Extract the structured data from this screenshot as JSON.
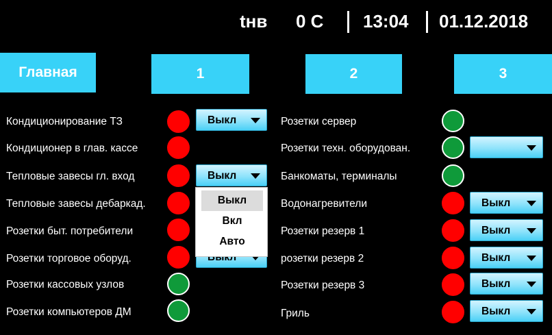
{
  "header": {
    "indicator_label": "tнв",
    "temperature": "0 C",
    "time": "13:04",
    "date": "01.12.2018"
  },
  "nav": [
    {
      "label": "Главная"
    },
    {
      "label": "1"
    },
    {
      "label": "2"
    },
    {
      "label": "3"
    }
  ],
  "left_rows": [
    {
      "label": "Кондиционирование ТЗ",
      "status": "red",
      "control": "Выкл"
    },
    {
      "label": "Кондиционер в глав. кассе",
      "status": "red"
    },
    {
      "label": "Тепловые завесы гл. вход",
      "status": "red",
      "control": "Выкл"
    },
    {
      "label": "Тепловые завесы дебаркад.",
      "status": "red"
    },
    {
      "label": "Розетки быт. потребители",
      "status": "red"
    },
    {
      "label": "Розетки торговое оборуд.",
      "status": "red",
      "control": "Выкл"
    },
    {
      "label": "Розетки кассовых узлов",
      "status": "green"
    },
    {
      "label": "Розетки компьютеров ДМ",
      "status": "green"
    }
  ],
  "right_rows": [
    {
      "label": "Розетки сервер",
      "status": "green"
    },
    {
      "label": "Розетки техн. оборудован.",
      "status": "green",
      "control": ""
    },
    {
      "label": "Банкоматы, терминалы",
      "status": "green"
    },
    {
      "label": "Водонагревители",
      "status": "red",
      "control": "Выкл"
    },
    {
      "label": "Розетки резерв 1",
      "status": "red",
      "control": "Выкл"
    },
    {
      "label": "розетки резерв 2",
      "status": "red",
      "control": "Выкл"
    },
    {
      "label": "Розетки резерв 3",
      "status": "red",
      "control": "Выкл"
    },
    {
      "label": "Гриль",
      "status": "red",
      "control": "Выкл"
    }
  ],
  "open_dropdown": {
    "options": [
      "Выкл",
      "Вкл",
      "Авто"
    ],
    "selected": "Выкл"
  },
  "colors": {
    "background": "#000000",
    "accent": "#38d2f8",
    "status_on": "#0f9a3a",
    "status_off": "#ff0000"
  }
}
